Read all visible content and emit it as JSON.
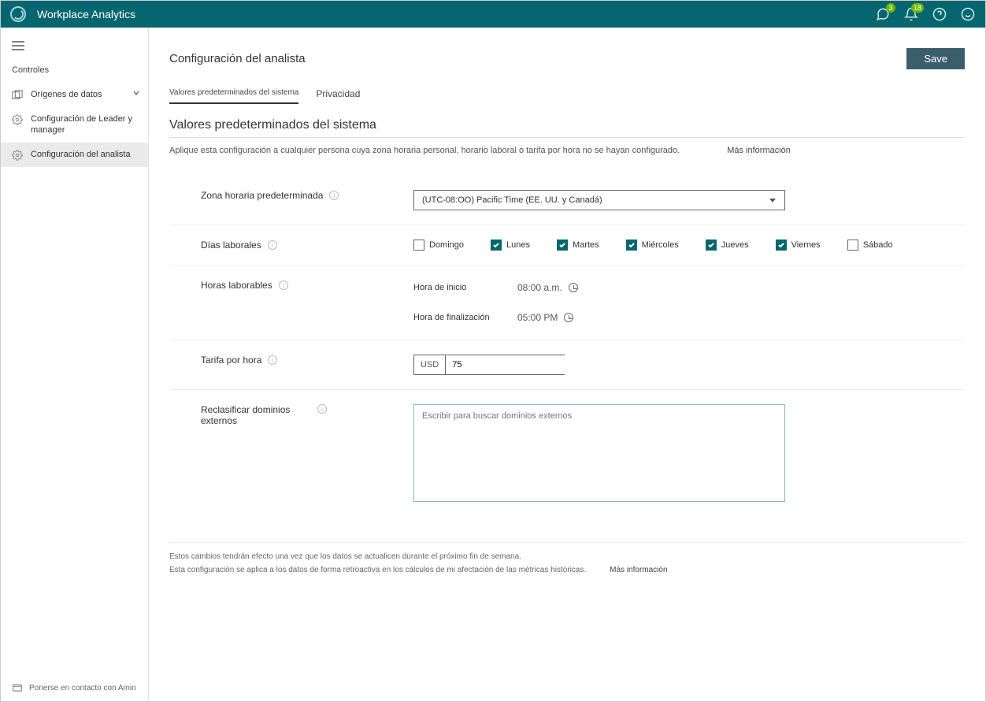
{
  "header": {
    "title": "Workplace Analytics",
    "badge_chat": "3",
    "badge_bell": "18"
  },
  "sidebar": {
    "section_label": "Controles",
    "items": [
      {
        "label": "Orígenes de datos"
      },
      {
        "label": "Configuración de Leader y manager"
      },
      {
        "label": "Configuración del analista"
      }
    ],
    "footer": "Ponerse en contacto con Amin"
  },
  "page": {
    "title": "Configuración del analista",
    "save_label": "Save",
    "tabs": {
      "defaults": "Valores predeterminados del sistema",
      "privacy": "Privacidad"
    },
    "section_title": "Valores predeterminados del sistema",
    "section_desc": "Aplique esta configuración a cualquier persona cuya zona horaria personal, horario laboral o tarifa por hora no se hayan configurado.",
    "more_info": "Más información"
  },
  "fields": {
    "timezone": {
      "label": "Zona horaria predeterminada",
      "value": "(UTC-08:OO) Pacific Time (EE. UU. y Canadá)"
    },
    "workdays": {
      "label": "Días laborales",
      "days": [
        {
          "name": "Domingo",
          "checked": false
        },
        {
          "name": "Lunes",
          "checked": true
        },
        {
          "name": "Martes",
          "checked": true
        },
        {
          "name": "Miércoles",
          "checked": true
        },
        {
          "name": "Jueves",
          "checked": true
        },
        {
          "name": "Viernes",
          "checked": true
        },
        {
          "name": "Sábado",
          "checked": false
        }
      ]
    },
    "workhours": {
      "label": "Horas laborables",
      "start_label": "Hora de inicio",
      "start_value": "08:00 a.m.",
      "end_label": "Hora de finalización",
      "end_value": "05:00 PM"
    },
    "rate": {
      "label": "Tarifa por hora",
      "currency": "USD",
      "value": "75"
    },
    "reclassify": {
      "label": "Reclasificar dominios externos",
      "placeholder": "Escribir para buscar dominios externos"
    }
  },
  "footer": {
    "note1": "Estos cambios tendrán efecto una vez que los datos se actualicen durante el próximo fin de semana.",
    "note2": "Esta configuración se aplica a los datos de forma retroactiva en los cálculos de mi afectación de las métricas históricas.",
    "more": "Más información"
  }
}
